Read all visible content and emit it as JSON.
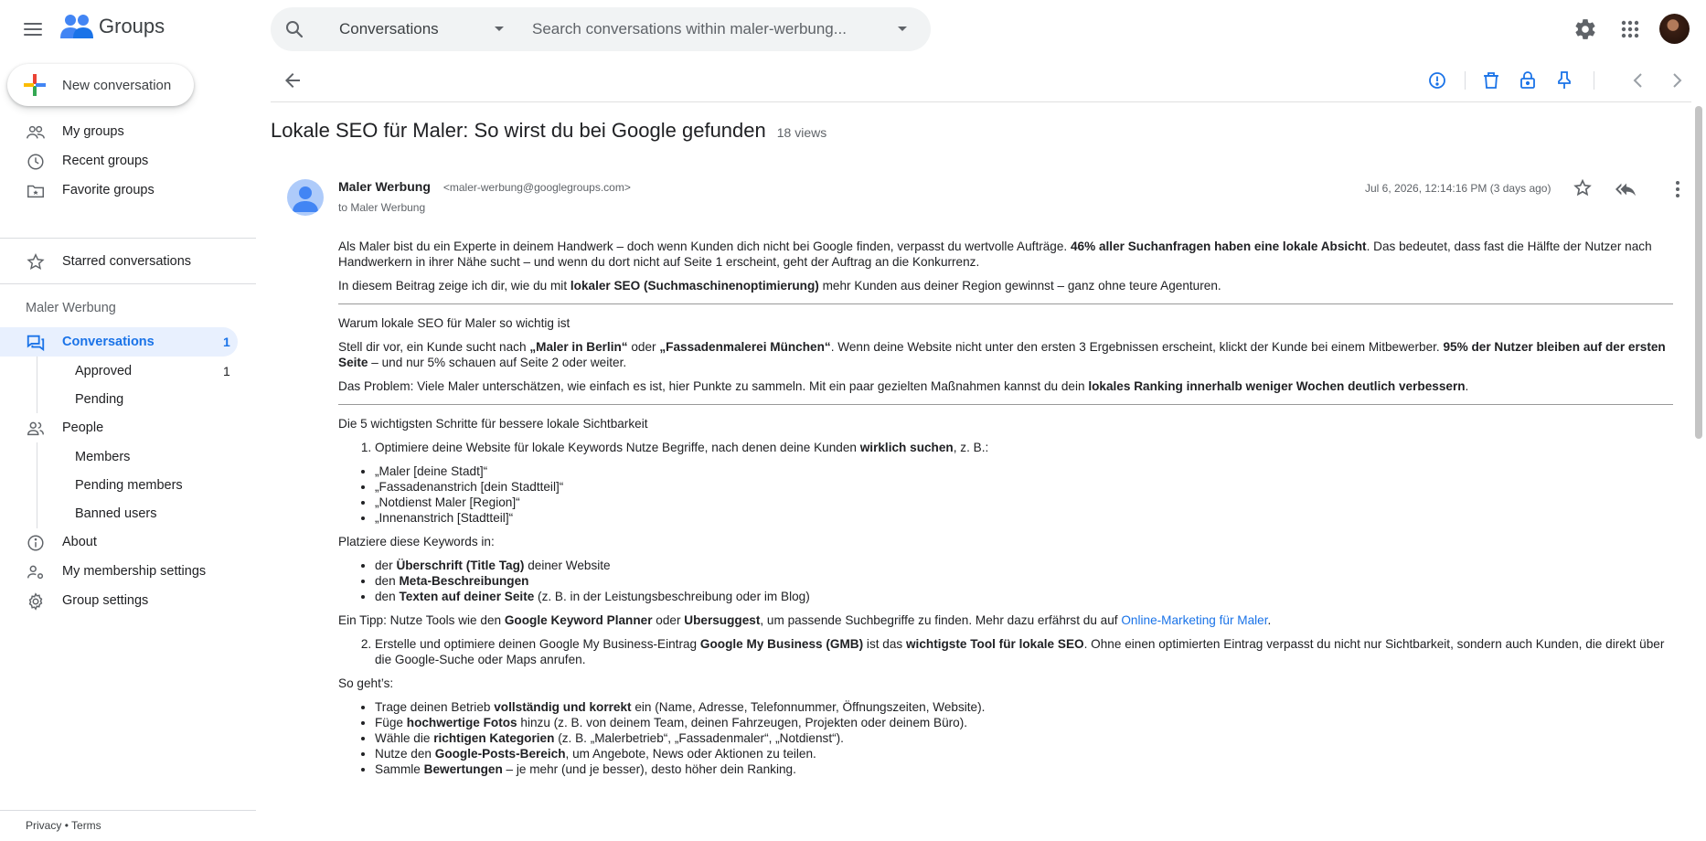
{
  "app": {
    "name": "Groups"
  },
  "search": {
    "scope": "Conversations",
    "placeholder": "Search conversations within maler-werbung..."
  },
  "sidebar": {
    "new_conversation": "New conversation",
    "top_items": [
      {
        "label": "My groups",
        "icon": "people-outline-icon"
      },
      {
        "label": "Recent groups",
        "icon": "clock-icon"
      },
      {
        "label": "Favorite groups",
        "icon": "folder-star-icon"
      }
    ],
    "starred": "Starred conversations",
    "group_name": "Maler Werbung",
    "conversations": {
      "label": "Conversations",
      "count": "1"
    },
    "approved": {
      "label": "Approved",
      "count": "1"
    },
    "pending": "Pending",
    "people": "People",
    "members": "Members",
    "pending_members": "Pending members",
    "banned_users": "Banned users",
    "about": "About",
    "membership_settings": "My membership settings",
    "group_settings": "Group settings",
    "footer": {
      "privacy": "Privacy",
      "separator": "•",
      "terms": "Terms"
    }
  },
  "conversation": {
    "title": "Lokale SEO für Maler: So wirst du bei Google gefunden",
    "views": "18 views",
    "sender_name": "Maler Werbung",
    "sender_email": "<maler-werbung@googlegroups.com>",
    "recipient": "to Maler Werbung",
    "date": "Jul 6, 2026, 12:14:16 PM (3 days ago)"
  },
  "message": {
    "p1_a": "Als Maler bist du ein Experte in deinem Handwerk – doch wenn Kunden dich nicht bei Google finden, verpasst du wertvolle Aufträge. ",
    "p1_b": "46% aller Suchanfragen haben eine lokale Absicht",
    "p1_c": ". Das bedeutet, dass fast die Hälfte der Nutzer nach Handwerkern in ihrer Nähe sucht – und wenn du dort nicht auf Seite 1 erscheint, geht der Auftrag an die Konkurrenz.",
    "p2_a": "In diesem Beitrag zeige ich dir, wie du mit ",
    "p2_b": "lokaler SEO (Suchmaschinenoptimierung)",
    "p2_c": " mehr Kunden aus deiner Region gewinnst – ganz ohne teure Agenturen.",
    "h1": "Warum lokale SEO für Maler so wichtig ist",
    "p3_a": "Stell dir vor, ein Kunde sucht nach ",
    "p3_b": "„Maler in Berlin“",
    "p3_c": " oder ",
    "p3_d": "„Fassadenmalerei München“",
    "p3_e": ". Wenn deine Website nicht unter den ersten 3 Ergebnissen erscheint, klickt der Kunde bei einem Mitbewerber. ",
    "p3_f": "95% der Nutzer bleiben auf der ersten Seite",
    "p3_g": " – und nur 5% schauen auf Seite 2 oder weiter.",
    "p4_a": "Das Problem: Viele Maler unterschätzen, wie einfach es ist, hier Punkte zu sammeln. Mit ein paar gezielten Maßnahmen kannst du dein ",
    "p4_b": "lokales Ranking innerhalb weniger Wochen deutlich verbessern",
    "p4_c": ".",
    "h2": "Die 5 wichtigsten Schritte für bessere lokale Sichtbarkeit",
    "step1_a": "Optimiere deine Website für lokale Keywords Nutze Begriffe, nach denen deine Kunden ",
    "step1_b": "wirklich suchen",
    "step1_c": ", z. B.:",
    "keywords": [
      "„Maler [deine Stadt]“",
      "„Fassadenanstrich [dein Stadtteil]“",
      "„Notdienst Maler [Region]“",
      "„Innenanstrich [Stadtteil]“"
    ],
    "place_intro": "Platziere diese Keywords in:",
    "place1_a": "der ",
    "place1_b": "Überschrift (Title Tag)",
    "place1_c": " deiner Website",
    "place2_a": "den ",
    "place2_b": "Meta-Beschreibungen",
    "place3_a": "den ",
    "place3_b": "Texten auf deiner Seite",
    "place3_c": " (z. B. in der Leistungsbeschreibung oder im Blog)",
    "tip_a": "Ein Tipp: Nutze Tools wie den ",
    "tip_b": "Google Keyword Planner",
    "tip_c": " oder ",
    "tip_d": "Ubersuggest",
    "tip_e": ", um passende Suchbegriffe zu finden. Mehr dazu erfährst du auf ",
    "tip_link": "Online-Marketing für Maler",
    "tip_f": ".",
    "step2_a": "Erstelle und optimiere deinen Google My Business-Eintrag ",
    "step2_b": "Google My Business (GMB)",
    "step2_c": " ist das ",
    "step2_d": "wichtigste Tool für lokale SEO",
    "step2_e": ". Ohne einen optimierten Eintrag verpasst du nicht nur Sichtbarkeit, sondern auch Kunden, die direkt über die Google-Suche oder Maps anrufen.",
    "howto": "So geht’s:",
    "b1_a": "Trage deinen Betrieb ",
    "b1_b": "vollständig und korrekt",
    "b1_c": " ein (Name, Adresse, Telefonnummer, Öffnungszeiten, Website).",
    "b2_a": "Füge ",
    "b2_b": "hochwertige Fotos",
    "b2_c": " hinzu (z. B. von deinem Team, deinen Fahrzeugen, Projekten oder deinem Büro).",
    "b3_a": "Wähle die ",
    "b3_b": "richtigen Kategorien",
    "b3_c": " (z. B. „Malerbetrieb“, „Fassadenmaler“, „Notdienst“).",
    "b4_a": "Nutze den ",
    "b4_b": "Google-Posts-Bereich",
    "b4_c": ", um Angebote, News oder Aktionen zu teilen.",
    "b5_a": "Sammle ",
    "b5_b": "Bewertungen",
    "b5_c": " – je mehr (und je besser), desto höher dein Ranking."
  },
  "colors": {
    "accent": "#1a73e8",
    "active_bg": "#e8f0fe",
    "icon": "#5f6368"
  }
}
